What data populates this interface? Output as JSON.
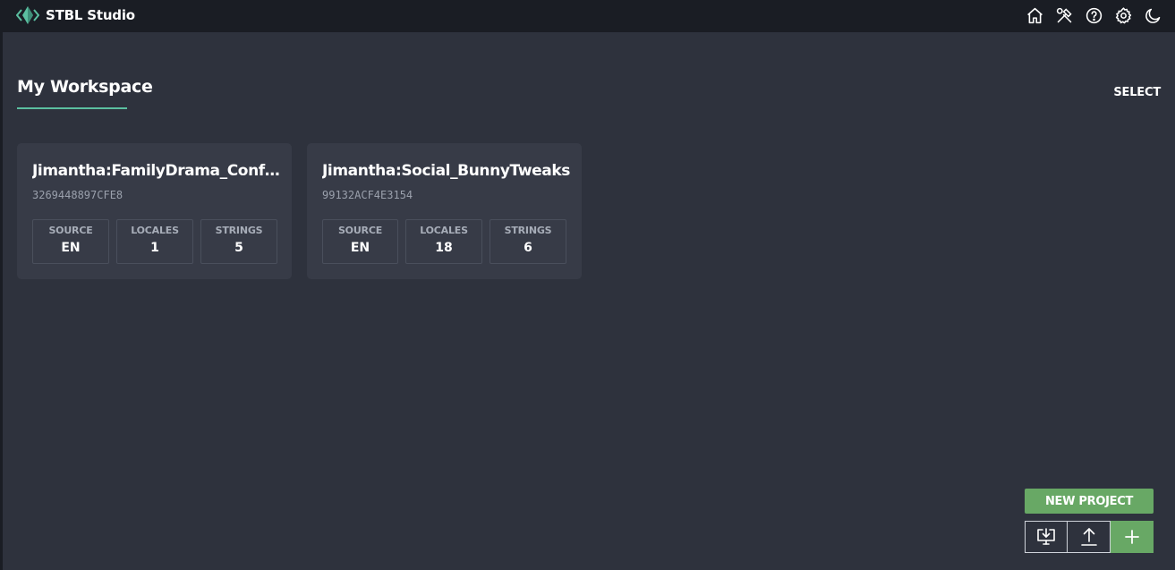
{
  "app": {
    "title": "STBL Studio",
    "accent_color": "#5bbfa0"
  },
  "topbar": {
    "icons": [
      "home-icon",
      "tools-icon",
      "help-icon",
      "settings-icon",
      "moon-icon"
    ]
  },
  "workspace": {
    "title": "My Workspace",
    "select_label": "SELECT"
  },
  "projects": [
    {
      "title": "Jimantha:FamilyDrama_Conf…",
      "id": "3269448897CFE8",
      "stats": [
        {
          "label": "SOURCE",
          "value": "EN"
        },
        {
          "label": "LOCALES",
          "value": "1"
        },
        {
          "label": "STRINGS",
          "value": "5"
        }
      ]
    },
    {
      "title": "Jimantha:Social_BunnyTweaks",
      "id": "99132ACF4E3154",
      "stats": [
        {
          "label": "SOURCE",
          "value": "EN"
        },
        {
          "label": "LOCALES",
          "value": "18"
        },
        {
          "label": "STRINGS",
          "value": "6"
        }
      ]
    }
  ],
  "actions": {
    "new_project_label": "NEW PROJECT",
    "buttons": [
      "download-icon",
      "upload-icon",
      "plus-icon"
    ],
    "primary_color": "#68a865"
  }
}
